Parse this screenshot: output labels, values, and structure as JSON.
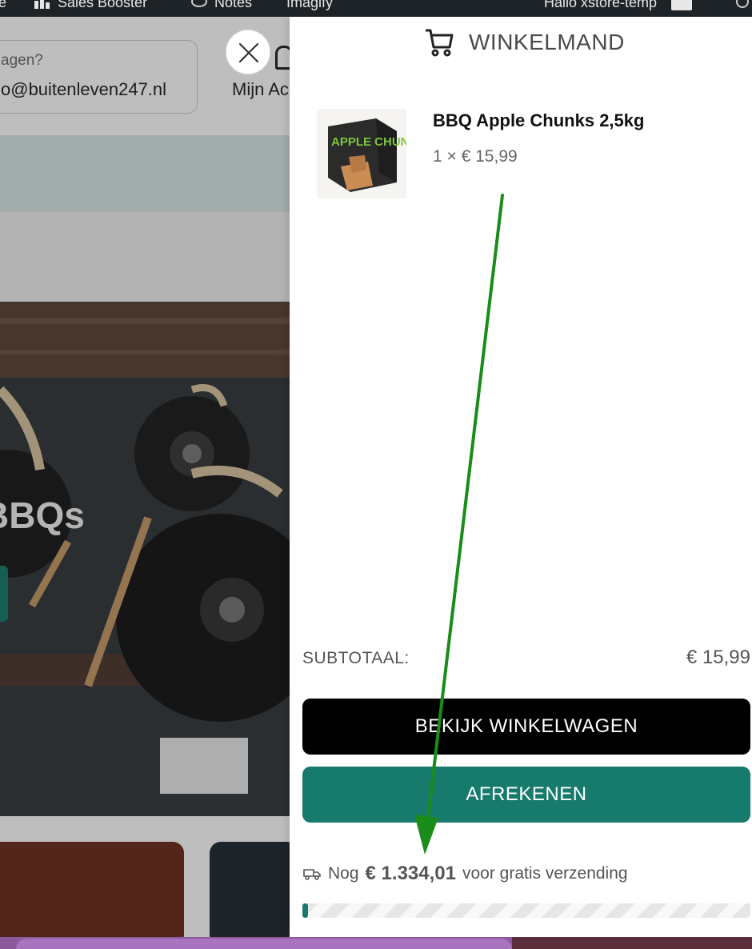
{
  "admin_bar": {
    "left_item_fragment": "e",
    "sales_booster": "Sales Booster",
    "notes": "Notes",
    "imagify": "Imagify",
    "greeting": "Hallo xstore-temp"
  },
  "background_page": {
    "contact_question_fragment": "agen?",
    "contact_email_fragment": "o@buitenleven247.nl",
    "account_label_fragment": "Mijn Ac",
    "hero_title_fragment": "BBQs"
  },
  "cart": {
    "title": "WINKELMAND",
    "items": [
      {
        "name": "BBQ Apple Chunks 2,5kg",
        "price_line": "1 × € 15,99",
        "image_text": "APPLE CHUNKS"
      }
    ],
    "subtotal_label": "SUBTOTAAL:",
    "subtotal_value": "€ 15,99",
    "view_cart_label": "BEKIJK WINKELWAGEN",
    "checkout_label": "AFREKENEN",
    "shipping": {
      "prefix": "Nog",
      "amount": "€ 1.334,01",
      "suffix": "voor gratis verzending",
      "progress_fraction": 0.012
    }
  },
  "icons": {
    "close": "close-icon",
    "cart": "cart-icon",
    "truck": "truck-icon",
    "account": "user-icon",
    "search": "search-icon"
  },
  "colors": {
    "accent": "#167a6c",
    "button_dark": "#000000",
    "annotation_arrow": "#1a8c1a"
  }
}
